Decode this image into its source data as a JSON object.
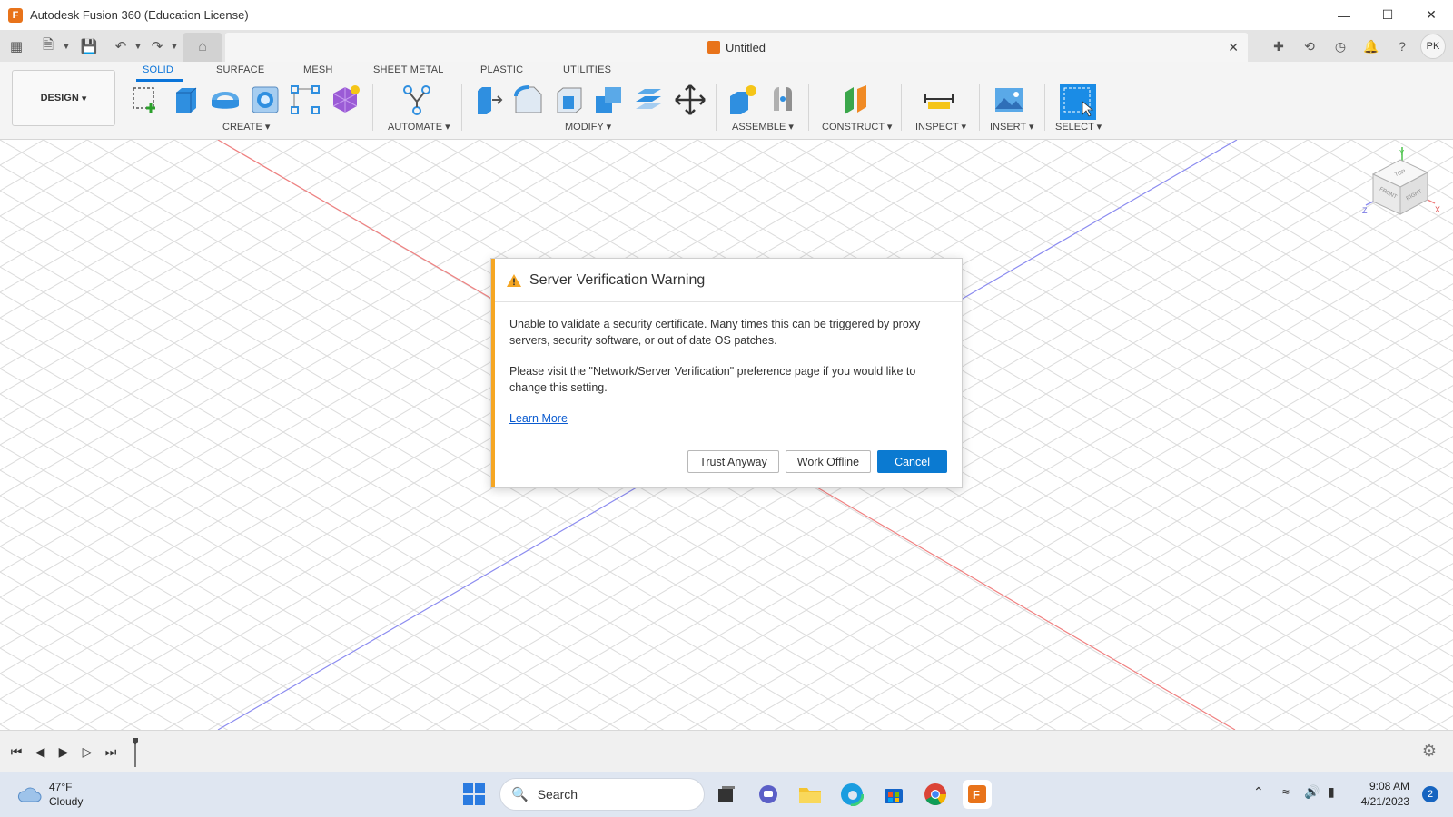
{
  "window": {
    "title": "Autodesk Fusion 360 (Education License)",
    "controls": [
      "minimize",
      "maximize",
      "close"
    ]
  },
  "document_tab": {
    "name": "Untitled"
  },
  "user": {
    "initials": "PK"
  },
  "ribbon": {
    "workspace": "DESIGN",
    "tabs": [
      "SOLID",
      "SURFACE",
      "MESH",
      "SHEET METAL",
      "PLASTIC",
      "UTILITIES"
    ],
    "active_tab": "SOLID",
    "groups": [
      "CREATE",
      "AUTOMATE",
      "MODIFY",
      "ASSEMBLE",
      "CONSTRUCT",
      "INSPECT",
      "INSERT",
      "SELECT"
    ]
  },
  "dialog": {
    "title": "Server Verification Warning",
    "paragraph1": "Unable to validate a security certificate. Many times this can be triggered by proxy servers, security software, or out of date OS patches.",
    "paragraph2": "Please visit the \"Network/Server Verification\" preference page if you would like to change this setting.",
    "link": "Learn More",
    "buttons": {
      "trust": "Trust Anyway",
      "offline": "Work Offline",
      "cancel": "Cancel"
    },
    "accent_color": "#f5a623",
    "primary_color": "#0b7ad1"
  },
  "viewcube": {
    "faces": [
      "TOP",
      "FRONT",
      "RIGHT"
    ],
    "axes": [
      "Y",
      "Z",
      "X"
    ]
  },
  "taskbar": {
    "weather": {
      "temp": "47°F",
      "condition": "Cloudy"
    },
    "search_placeholder": "Search",
    "clock": {
      "time": "9:08 AM",
      "date": "4/21/2023"
    },
    "notification_count": "2"
  },
  "colors": {
    "accent": "#0a74d9",
    "x_axis": "#f08080",
    "z_axis": "#8c8cf0",
    "brand": "#e8731a"
  }
}
